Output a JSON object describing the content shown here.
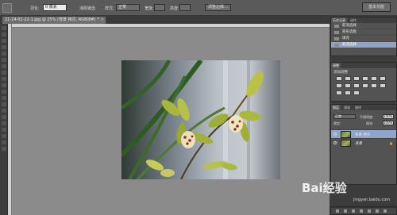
{
  "options_bar": {
    "feather_label": "羽化:",
    "feather_value": "0 像素",
    "antialias_label": "消除锯齿",
    "style_label": "样式:",
    "style_value": "正常",
    "width_label": "宽度:",
    "height_label": "高度:",
    "refine_edge_label": "调整边缘...",
    "workspace_label": "基本功能"
  },
  "document_tab": {
    "title": "21-24-02-22-1.jpg @ 25% (背景 拷贝, RGB/8#) *",
    "close_symbol": "×"
  },
  "history_panel": {
    "tabs": [
      "历史记录",
      "动作"
    ],
    "items": [
      {
        "label": "取消选择",
        "active": false
      },
      {
        "label": "矩形选框",
        "active": false
      },
      {
        "label": "填充",
        "active": false
      },
      {
        "label": "取消选择",
        "active": true
      }
    ]
  },
  "adjustments_panel": {
    "tab": "调整",
    "title": "添加调整"
  },
  "layers_panel": {
    "tabs": [
      "图层",
      "通道",
      "路径"
    ],
    "blend_mode": "正常",
    "opacity_label": "不透明度:",
    "opacity_value": "100%",
    "lock_label": "锁定:",
    "fill_label": "填充:",
    "fill_value": "100%",
    "layers": [
      {
        "name": "背景 拷贝",
        "active": true,
        "locked": false
      },
      {
        "name": "背景",
        "active": false,
        "locked": true
      }
    ]
  },
  "watermark": {
    "logo_text": "Bai经验",
    "url": "jingyan.baidu.com"
  },
  "icons": {
    "eye": "eye-icon",
    "lock": "lock-icon",
    "marquee": "marquee-tool-icon"
  },
  "colors": {
    "canvas_bg": "#8b8b8b",
    "panel_bg": "#535353",
    "selection": "#8ea4c8"
  }
}
